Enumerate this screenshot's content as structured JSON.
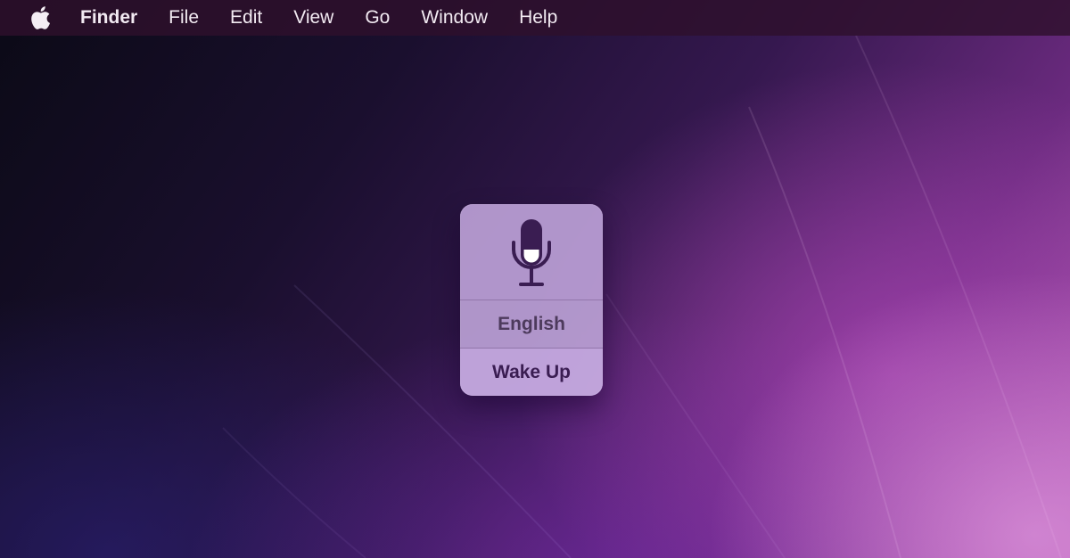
{
  "menubar": {
    "apple_icon": "apple-logo-icon",
    "app_name": "Finder",
    "items": [
      {
        "label": "File"
      },
      {
        "label": "Edit"
      },
      {
        "label": "View"
      },
      {
        "label": "Go"
      },
      {
        "label": "Window"
      },
      {
        "label": "Help"
      }
    ]
  },
  "dictation": {
    "mic_icon": "microphone-icon",
    "language_label": "English",
    "wake_label": "Wake Up"
  },
  "colors": {
    "menubar_bg": "#2e102c",
    "panel_bg": "#c4aade",
    "mic_color": "#3a1d52"
  }
}
